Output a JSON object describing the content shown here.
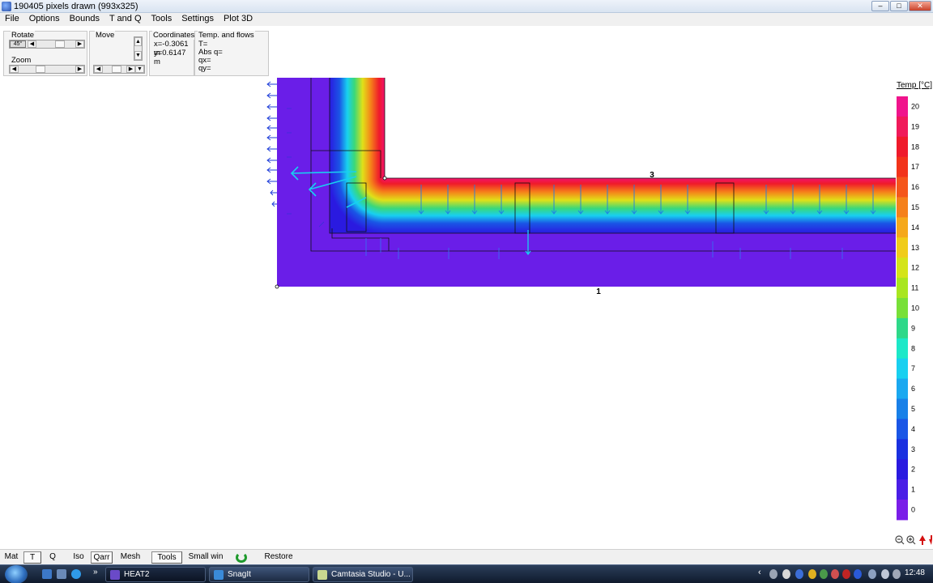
{
  "window": {
    "title": "190405 pixels drawn (993x325)"
  },
  "menu": [
    "File",
    "Options",
    "Bounds",
    "T and Q",
    "Tools",
    "Settings",
    "Plot 3D"
  ],
  "controls": {
    "rotate_label": "Rotate",
    "rotate_button": "45°",
    "zoom_label": "Zoom",
    "move_label": "Move",
    "coords_label": "Coordinates",
    "coord_x": "x=-0.3061 m",
    "coord_y": "y=0.6147 m",
    "temp_label": "Temp. and flows",
    "temp_T": "T=",
    "temp_absq": "Abs q=",
    "temp_qx": "qx=",
    "temp_qy": "qy="
  },
  "plot": {
    "label_top": "3",
    "label_bottom": "1"
  },
  "legend": {
    "title": "Temp [°C]",
    "ticks": [
      "20",
      "19",
      "18",
      "17",
      "16",
      "15",
      "14",
      "13",
      "12",
      "11",
      "10",
      "9",
      "8",
      "7",
      "6",
      "5",
      "4",
      "3",
      "2",
      "1",
      "0"
    ],
    "colors": [
      "#f0148c",
      "#f01a5a",
      "#ef1a2b",
      "#f2331a",
      "#f5561a",
      "#f5801a",
      "#f5a81a",
      "#f0cc18",
      "#d4e418",
      "#a8e620",
      "#78e038",
      "#2ed889",
      "#1ce8c8",
      "#18d0f0",
      "#1aa8f0",
      "#1880e8",
      "#1a56e6",
      "#1a30e0",
      "#2a1ae0",
      "#4a1ee6",
      "#7a1ee8"
    ],
    "colors_note": ""
  },
  "bottom_toolbar": [
    "Mat",
    "T",
    "Q",
    "Iso",
    "Qarr",
    "Mesh",
    "Tools",
    "Small win",
    "Restore"
  ],
  "taskbar": {
    "tasks": [
      "HEAT2",
      "SnagIt",
      "Camtasia Studio - U..."
    ],
    "clock": "12:48"
  }
}
